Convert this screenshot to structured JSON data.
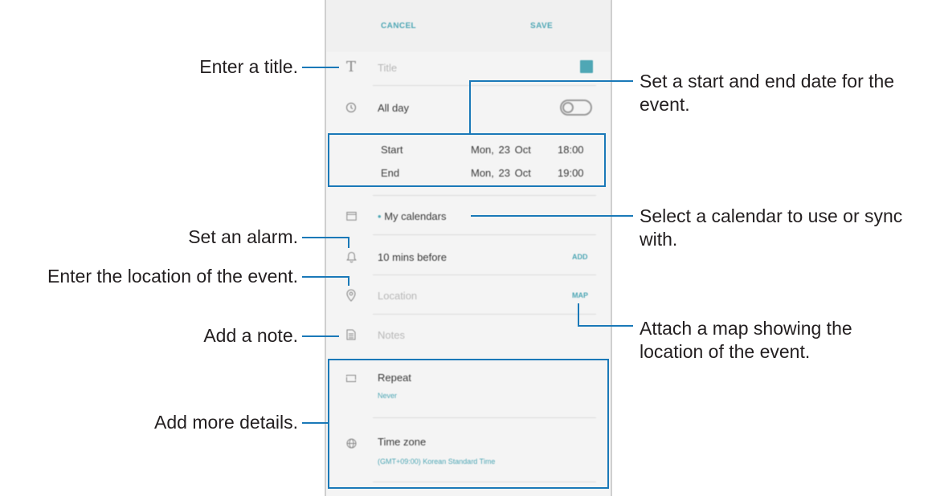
{
  "screen": {
    "top_bar": {
      "cancel_label": "CANCEL",
      "save_label": "SAVE"
    },
    "title_field": {
      "placeholder": "Title",
      "color": "#4fa7b5"
    },
    "all_day": {
      "label": "All day",
      "enabled": false
    },
    "start": {
      "label": "Start",
      "date": "Mon, 23 Oct",
      "time": "18:00"
    },
    "end": {
      "label": "End",
      "date": "Mon, 23 Oct",
      "time": "19:00"
    },
    "calendar": {
      "label": "My calendars"
    },
    "alarm": {
      "label": "10 mins before",
      "add_label": "ADD"
    },
    "location": {
      "placeholder": "Location",
      "map_label": "MAP"
    },
    "notes": {
      "placeholder": "Notes"
    },
    "repeat": {
      "label": "Repeat",
      "value": "Never"
    },
    "time_zone": {
      "label": "Time zone",
      "value": "(GMT+09:00) Korean Standard Time"
    }
  },
  "callouts": {
    "title": "Enter a title.",
    "date_line1": "Set a start and end date for the",
    "date_line2": "event.",
    "calendar_line1": "Select a calendar to use or sync",
    "calendar_line2": "with.",
    "alarm": "Set an alarm.",
    "location": "Enter the location of the event.",
    "note": "Add a note.",
    "map_line1": "Attach a map showing the",
    "map_line2": "location of the event.",
    "details": "Add more details."
  },
  "colors": {
    "accent": "#4fa7b5",
    "callout_line": "#1a79b8"
  }
}
